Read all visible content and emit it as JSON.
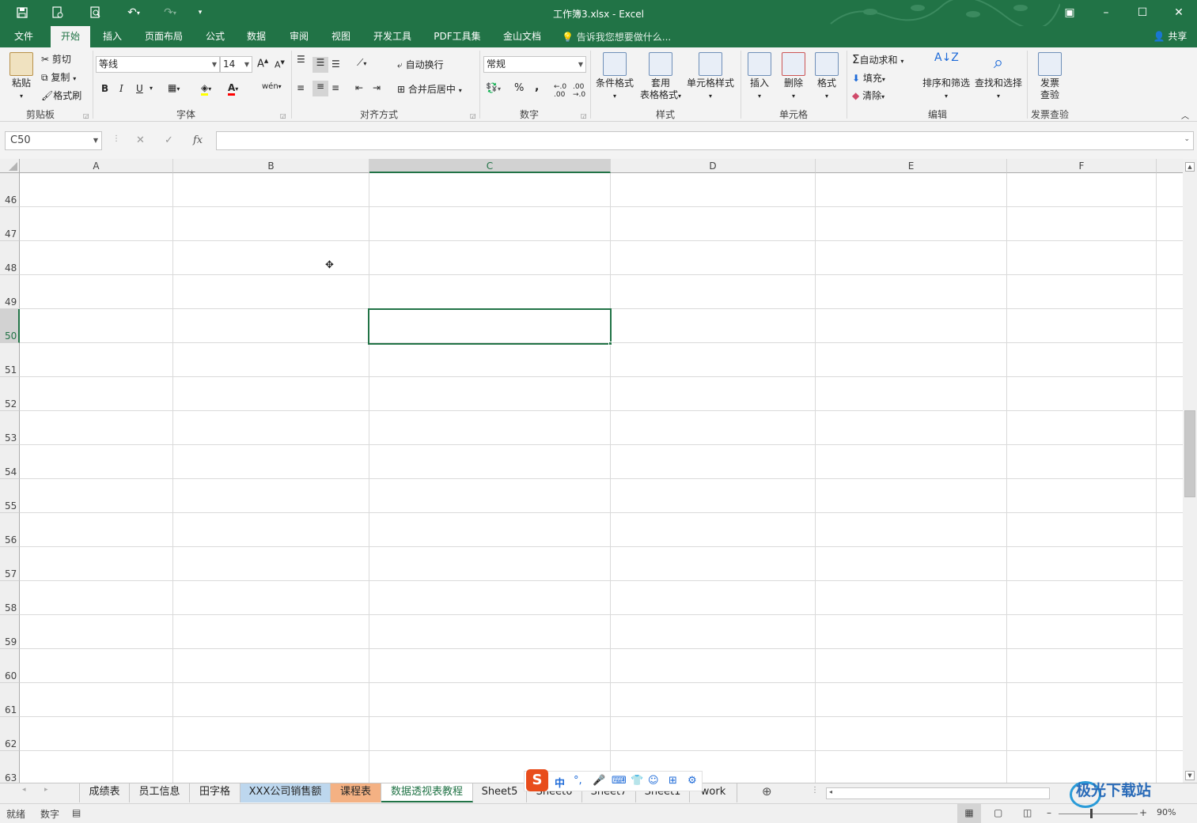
{
  "app": {
    "title": "工作簿3.xlsx - Excel"
  },
  "quick_access": {
    "save": "save-icon",
    "touch": "touch-mode-icon",
    "preview": "print-preview-icon",
    "undo": "undo-icon",
    "redo": "redo-icon",
    "customize": "customize-icon"
  },
  "ribbon_tabs": [
    "文件",
    "开始",
    "插入",
    "页面布局",
    "公式",
    "数据",
    "审阅",
    "视图",
    "开发工具",
    "PDF工具集",
    "金山文档"
  ],
  "active_tab": "开始",
  "tell_me": "告诉我您想要做什么...",
  "share": "共享",
  "clipboard": {
    "paste": "粘贴",
    "cut": "剪切",
    "copy": "复制",
    "format_painter": "格式刷",
    "label": "剪贴板"
  },
  "font": {
    "name": "等线",
    "size": "14",
    "bold": "B",
    "italic": "I",
    "underline": "U",
    "phonetic": "wén",
    "label": "字体"
  },
  "alignment": {
    "wrap": "自动换行",
    "merge": "合并后居中",
    "label": "对齐方式"
  },
  "number": {
    "format": "常规",
    "percent": "%",
    "comma": ",",
    "label": "数字"
  },
  "styles": {
    "conditional": "条件格式",
    "table_1": "套用",
    "table_2": "表格格式",
    "cell_styles": "单元格样式",
    "label": "样式"
  },
  "cells": {
    "insert": "插入",
    "delete": "删除",
    "format": "格式",
    "label": "单元格"
  },
  "editing": {
    "autosum": "自动求和",
    "fill": "填充",
    "clear": "清除",
    "sort": "排序和筛选",
    "find": "查找和选择",
    "label": "编辑"
  },
  "invoice": {
    "btn_1": "发票",
    "btn_2": "查验",
    "label": "发票查验"
  },
  "formula_bar": {
    "name_box": "C50",
    "fx": "fx",
    "cancel": "✕",
    "enter": "✓",
    "value": ""
  },
  "columns": [
    "A",
    "B",
    "C",
    "D",
    "E",
    "F"
  ],
  "selected_column": "C",
  "rows": [
    "46",
    "47",
    "48",
    "49",
    "50",
    "51",
    "52",
    "53",
    "54",
    "55",
    "56",
    "57",
    "58",
    "59",
    "60",
    "61",
    "62",
    "63"
  ],
  "selected_row": "50",
  "sheet_tabs": [
    "成绩表",
    "员工信息",
    "田字格",
    "XXX公司销售额",
    "课程表",
    "数据透视表教程",
    "Sheet5",
    "Sheet6",
    "Sheet7",
    "Sheet1",
    "work"
  ],
  "active_sheet": "数据透视表教程",
  "tab_colors": {
    "XXX公司销售额": "#bdd7ee",
    "课程表": "#f4b183"
  },
  "status": {
    "ready": "就绪",
    "mode": "数字",
    "zoom": "90%"
  },
  "ime": {
    "lang": "中"
  },
  "watermark": "极光下载站",
  "colors": {
    "accent": "#217346"
  }
}
